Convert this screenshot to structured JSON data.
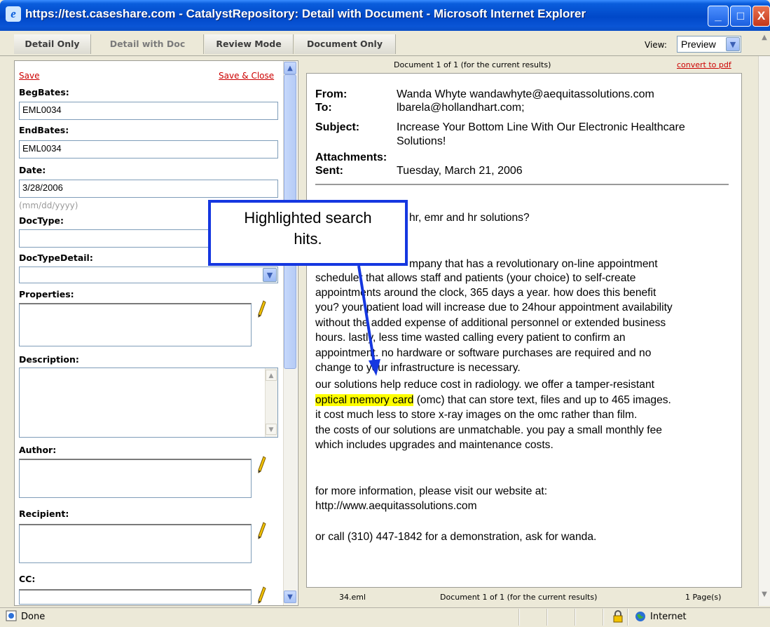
{
  "window": {
    "title": "https://test.caseshare.com - CatalystRepository: Detail with Document - Microsoft Internet Explorer",
    "minimize": "_",
    "maximize": "□",
    "close": "X"
  },
  "tabs": [
    {
      "label": "Detail Only"
    },
    {
      "label": "Detail with Doc",
      "active": true
    },
    {
      "label": "Review Mode"
    },
    {
      "label": "Document Only"
    }
  ],
  "view": {
    "label": "View:",
    "value": "Preview"
  },
  "form": {
    "save": "Save",
    "save_close": "Save & Close",
    "beg_bates_label": "BegBates:",
    "beg_bates_value": "EML0034",
    "end_bates_label": "EndBates:",
    "end_bates_value": "EML0034",
    "date_label": "Date:",
    "date_value": "3/28/2006",
    "date_hint": "(mm/dd/yyyy)",
    "doctype_label": "DocType:",
    "doctypedetail_label": "DocTypeDetail:",
    "properties_label": "Properties:",
    "description_label": "Description:",
    "author_label": "Author:",
    "recipient_label": "Recipient:",
    "cc_label": "CC:"
  },
  "document": {
    "header_status": "Document 1 of 1 (for the current results)",
    "convert": "convert to pdf",
    "from_label": "From:",
    "from_value": "Wanda Whyte wandawhyte@aequitassolutions.com",
    "to_label": "To:",
    "to_value": "lbarela@hollandhart.com;",
    "subject_label": "Subject:",
    "subject_value_1": "Increase Your Bottom Line With Our Electronic Healthcare",
    "subject_value_2": "Solutions!",
    "attachments_label": "Attachments:",
    "sent_label": "Sent:",
    "sent_value": "Tuesday, March 21, 2006",
    "body": {
      "line1_tail": "hr, emr and hr solutions?",
      "line2_tail": "mpany that has a revolutionary on-line appointment",
      "line3": "scheduler that allows staff and patients (your choice) to self-create",
      "line4": "appointments around the clock, 365 days a year. how does this benefit",
      "line5": "you? your patient load will increase due to 24hour appointment availability",
      "line6": "without the added expense of additional personnel or extended business",
      "line7": "hours. lastly, less time wasted calling every patient to confirm an",
      "line8": "appointment. no hardware or software purchases are required and no",
      "line9": "change to your infrastructure is necessary.",
      "line10": "our solutions help reduce cost in radiology. we offer a tamper-resistant",
      "line11_hit": "optical memory card",
      "line11_rest": " (omc) that can store text, files and up to 465 images.",
      "line12": "it cost much less to store x-ray images on the omc rather than film.",
      "line13": "the costs of our solutions are unmatchable. you pay a small monthly fee",
      "line14": "which includes upgrades and maintenance costs.",
      "line15": "for more information, please visit our website at:",
      "line16": "http://www.aequitassolutions.com",
      "line17": "or call (310) 447-1842 for a demonstration, ask for wanda."
    },
    "footer_file": "34.eml",
    "footer_status": "Document 1 of 1 (for the current results)",
    "footer_pages": "1 Page(s)"
  },
  "callout": {
    "line1": "Highlighted search",
    "line2": "hits."
  },
  "status": {
    "text": "Done",
    "zone": "Internet"
  },
  "colors": {
    "highlight": "#ffff00",
    "callout_border": "#1537e0",
    "link_red": "#cc0000",
    "title_blue": "#0a5ddc"
  }
}
